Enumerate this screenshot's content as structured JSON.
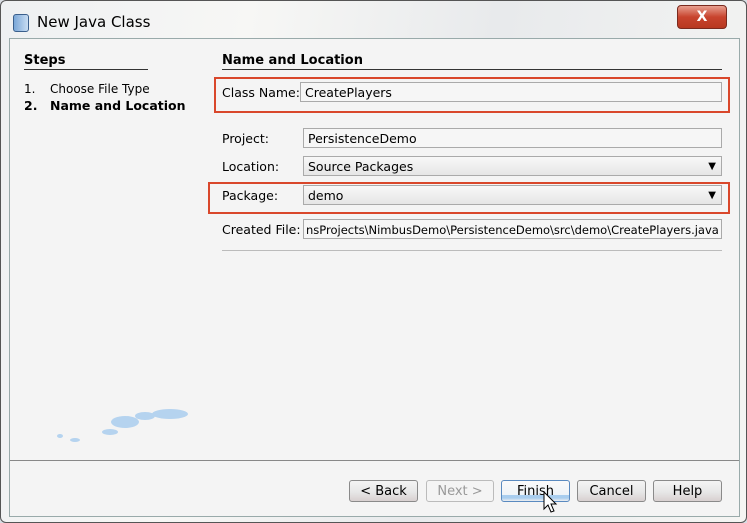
{
  "window": {
    "title": "New Java Class",
    "close_label": "X"
  },
  "steps": {
    "heading": "Steps",
    "items": [
      {
        "num": "1.",
        "label": "Choose File Type"
      },
      {
        "num": "2.",
        "label": "Name and Location"
      }
    ]
  },
  "panel": {
    "heading": "Name and Location",
    "class_name": {
      "label": "Class Name:",
      "value": "CreatePlayers"
    },
    "project": {
      "label": "Project:",
      "value": "PersistenceDemo"
    },
    "location": {
      "label": "Location:",
      "value": "Source Packages"
    },
    "package": {
      "label": "Package:",
      "value": "demo"
    },
    "created_file": {
      "label": "Created File:",
      "value": "nsProjects\\NimbusDemo\\PersistenceDemo\\src\\demo\\CreatePlayers.java"
    }
  },
  "buttons": {
    "back": "< Back",
    "next": "Next >",
    "finish": "Finish",
    "cancel": "Cancel",
    "help": "Help"
  },
  "colors": {
    "highlight": "#d9472b"
  }
}
